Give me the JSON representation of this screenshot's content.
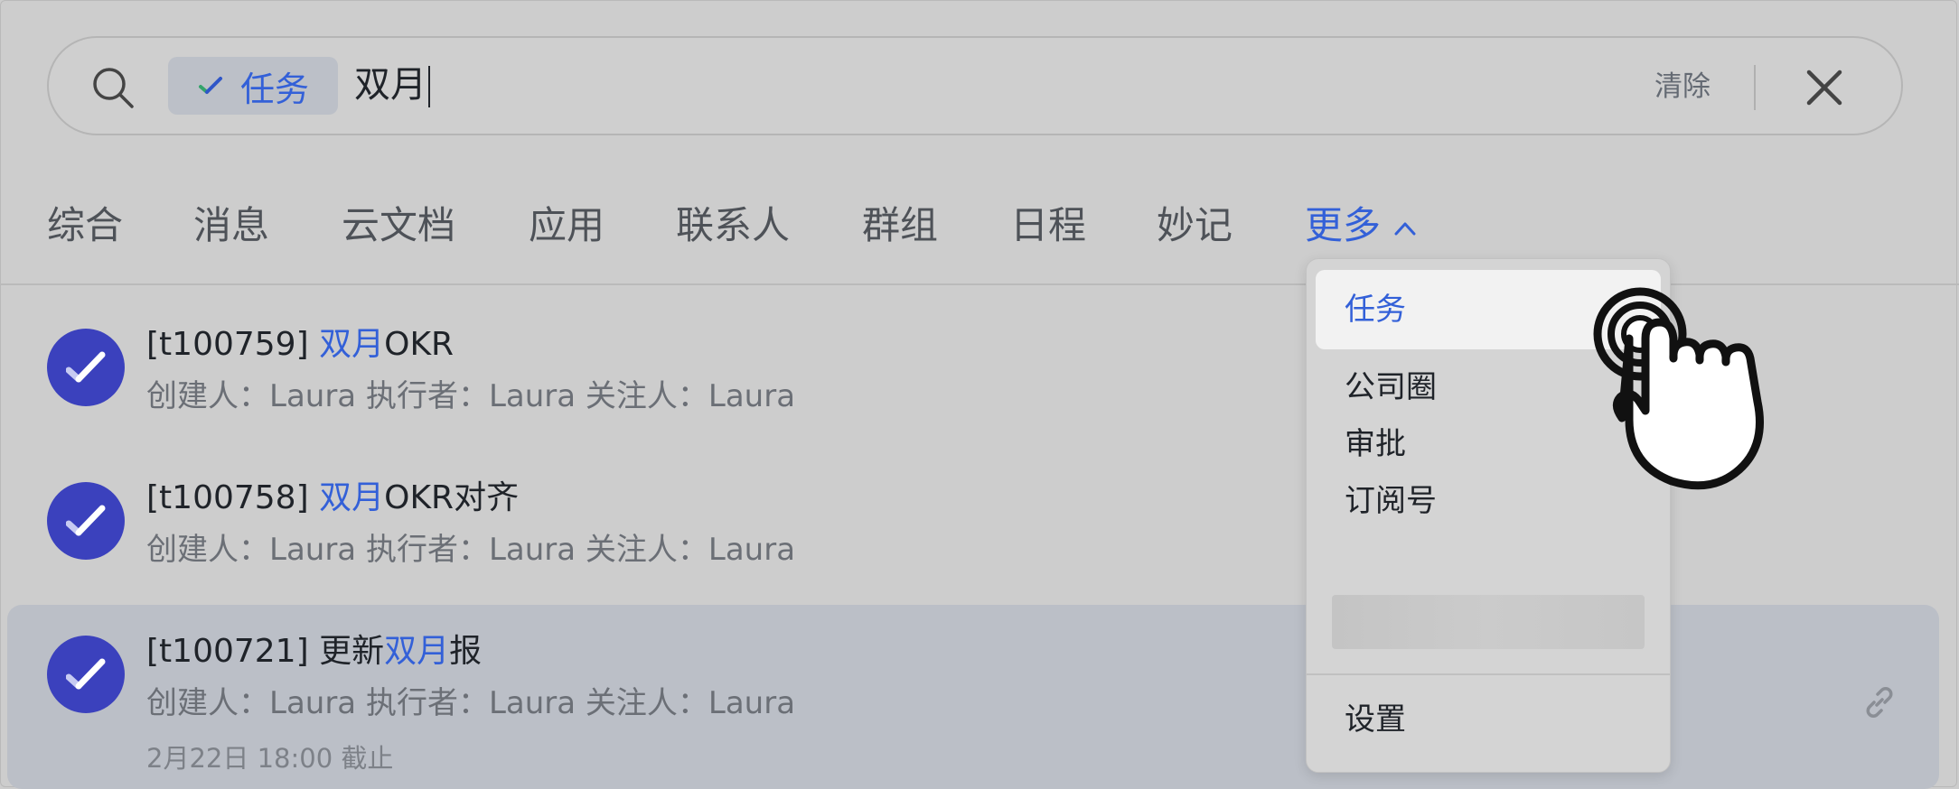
{
  "search": {
    "scope_chip": "任务",
    "query": "双月",
    "clear_label": "清除"
  },
  "tabs": [
    {
      "label": "综合"
    },
    {
      "label": "消息"
    },
    {
      "label": "云文档"
    },
    {
      "label": "应用"
    },
    {
      "label": "联系人"
    },
    {
      "label": "群组"
    },
    {
      "label": "日程"
    },
    {
      "label": "妙记"
    },
    {
      "label": "更多"
    }
  ],
  "results": [
    {
      "id": "[t100759]",
      "title_highlight": "双月",
      "title_rest": "OKR",
      "meta": "创建人：Laura 执行者：Laura 关注人：Laura"
    },
    {
      "id": "[t100758]",
      "title_highlight": "双月",
      "title_rest": "OKR对齐",
      "meta": "创建人：Laura 执行者：Laura 关注人：Laura"
    },
    {
      "id": "[t100721]",
      "title_prefix": "更新",
      "title_highlight": "双月",
      "title_rest": "报",
      "meta": "创建人：Laura 执行者：Laura 关注人：Laura",
      "due": "2月22日 18:00 截止"
    }
  ],
  "dropdown": {
    "items": [
      {
        "label": "任务",
        "selected": true
      },
      {
        "label": "公司圈"
      },
      {
        "label": "审批"
      },
      {
        "label": "订阅号"
      }
    ],
    "footer_item": "设置"
  },
  "colors": {
    "accent": "#3360d8",
    "avatar": "#3b41bd"
  }
}
